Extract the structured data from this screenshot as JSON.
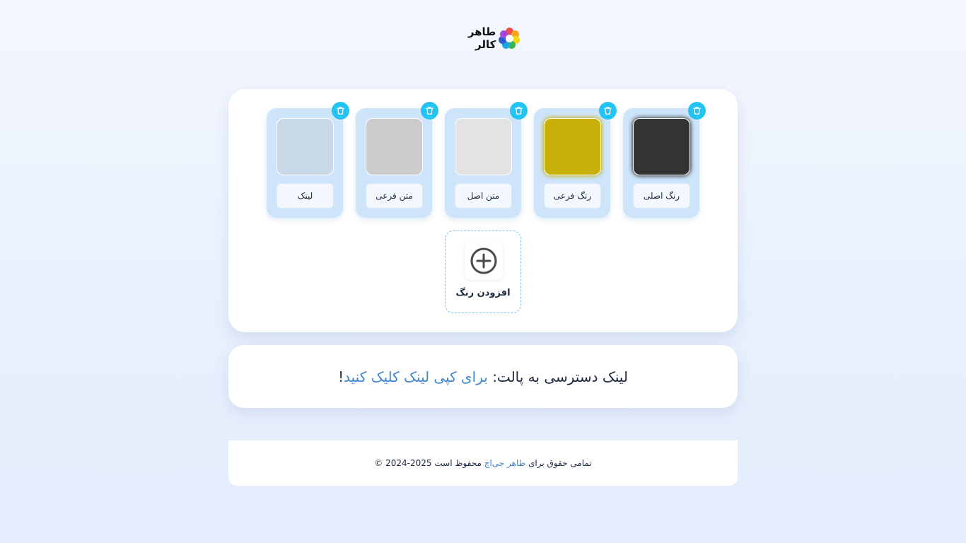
{
  "brand": {
    "name": "طاهر کالر"
  },
  "palette": {
    "colors": [
      {
        "label": "رنگ اصلی",
        "color": "#333333",
        "glow": "#333333"
      },
      {
        "label": "رنگ فرعی",
        "color": "#c8b008",
        "glow": "#c8b008"
      },
      {
        "label": "متن اصل",
        "color": "#e3e3e3",
        "glow": ""
      },
      {
        "label": "متن فرعی",
        "color": "#cccccc",
        "glow": ""
      },
      {
        "label": "لینک",
        "color": "#cad9e8",
        "glow": ""
      }
    ],
    "add_label": "افزودن رنگ"
  },
  "share": {
    "title": "لینک دسترسی به پالت:",
    "action": "برای کپی لینک کلیک کنید",
    "suffix": "!"
  },
  "footer": {
    "prefix": "تمامی حقوق برای",
    "author": "طاهر جی‌اچ",
    "suffix": "محفوظ است 2025-2024 ©"
  },
  "colors": {
    "accent": "#22c4f4",
    "link": "#3f86d0",
    "swatch_bg": "#cde4fb"
  }
}
